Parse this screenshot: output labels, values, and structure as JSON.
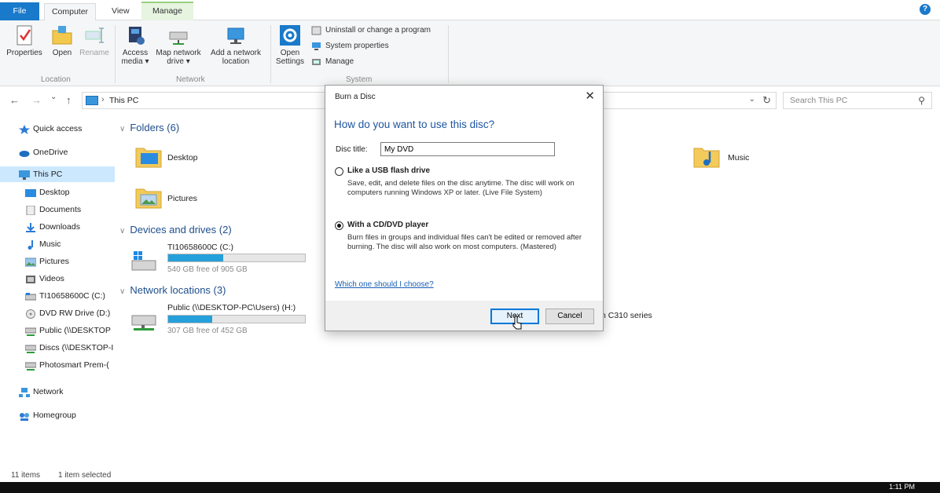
{
  "tabs": {
    "file": "File",
    "computer": "Computer",
    "view": "View",
    "manage": "Manage",
    "help": "?"
  },
  "ribbon": {
    "properties": "Properties",
    "open": "Open",
    "rename": "Rename",
    "location_group": "Location",
    "access_media_1": "Access",
    "access_media_2": "media ▾",
    "map_drive_1": "Map network",
    "map_drive_2": "drive ▾",
    "add_location_1": "Add a network",
    "add_location_2": "location",
    "network_group": "Network",
    "open_settings_1": "Open",
    "open_settings_2": "Settings",
    "uninstall": "Uninstall or change a program",
    "system_properties": "System properties",
    "manage": "Manage",
    "system_group": "System"
  },
  "address": {
    "back": "←",
    "forward": "→",
    "recent": "⌄",
    "up": "↑",
    "separator": "›",
    "path": "This PC",
    "dropdown": "⌄",
    "refresh": "↻",
    "search_placeholder": "Search This PC",
    "search_icon": "⚲"
  },
  "sidebar": {
    "items": [
      {
        "label": "Quick access"
      },
      {
        "label": "OneDrive"
      },
      {
        "label": "This PC"
      },
      {
        "label": "Desktop"
      },
      {
        "label": "Documents"
      },
      {
        "label": "Downloads"
      },
      {
        "label": "Music"
      },
      {
        "label": "Pictures"
      },
      {
        "label": "Videos"
      },
      {
        "label": "TI10658600C (C:)"
      },
      {
        "label": "DVD RW Drive (D:)"
      },
      {
        "label": "Public (\\\\DESKTOP"
      },
      {
        "label": "Discs (\\\\DESKTOP-I"
      },
      {
        "label": "Photosmart Prem-("
      },
      {
        "label": "Network"
      },
      {
        "label": "Homegroup"
      }
    ]
  },
  "content": {
    "folders_header": "Folders (6)",
    "desktop": "Desktop",
    "pictures": "Pictures",
    "music": "Music",
    "devices_header": "Devices and drives (2)",
    "drive_c_name": "TI10658600C (C:)",
    "drive_c_free": "540 GB free of 905 GB",
    "drive_c_used_fraction": 0.4,
    "network_header": "Network locations (3)",
    "public_name": "Public (\\\\DESKTOP-PC\\Users) (H:)",
    "public_free": "307 GB free of 452 GB",
    "public_used_fraction": 0.32,
    "printer_partial": "n C310 series"
  },
  "status": {
    "items": "11 items",
    "selected": "1 item selected"
  },
  "taskbar": {
    "clock": "1:11 PM"
  },
  "dialog": {
    "title": "Burn a Disc",
    "close": "✕",
    "heading": "How do you want to use this disc?",
    "disc_title_label": "Disc title:",
    "disc_title_value": "My DVD",
    "option_usb_title": "Like a USB flash drive",
    "option_usb_desc": "Save, edit, and delete files on the disc anytime. The disc will work on computers running Windows XP or later. (Live File System)",
    "option_cd_title": "With a CD/DVD player",
    "option_cd_desc": "Burn files in groups and individual files can't be edited or removed after burning. The disc will also work on most computers. (Mastered)",
    "help_link": "Which one should I choose?",
    "next": "Next",
    "cancel": "Cancel",
    "selected_option": "cd"
  }
}
